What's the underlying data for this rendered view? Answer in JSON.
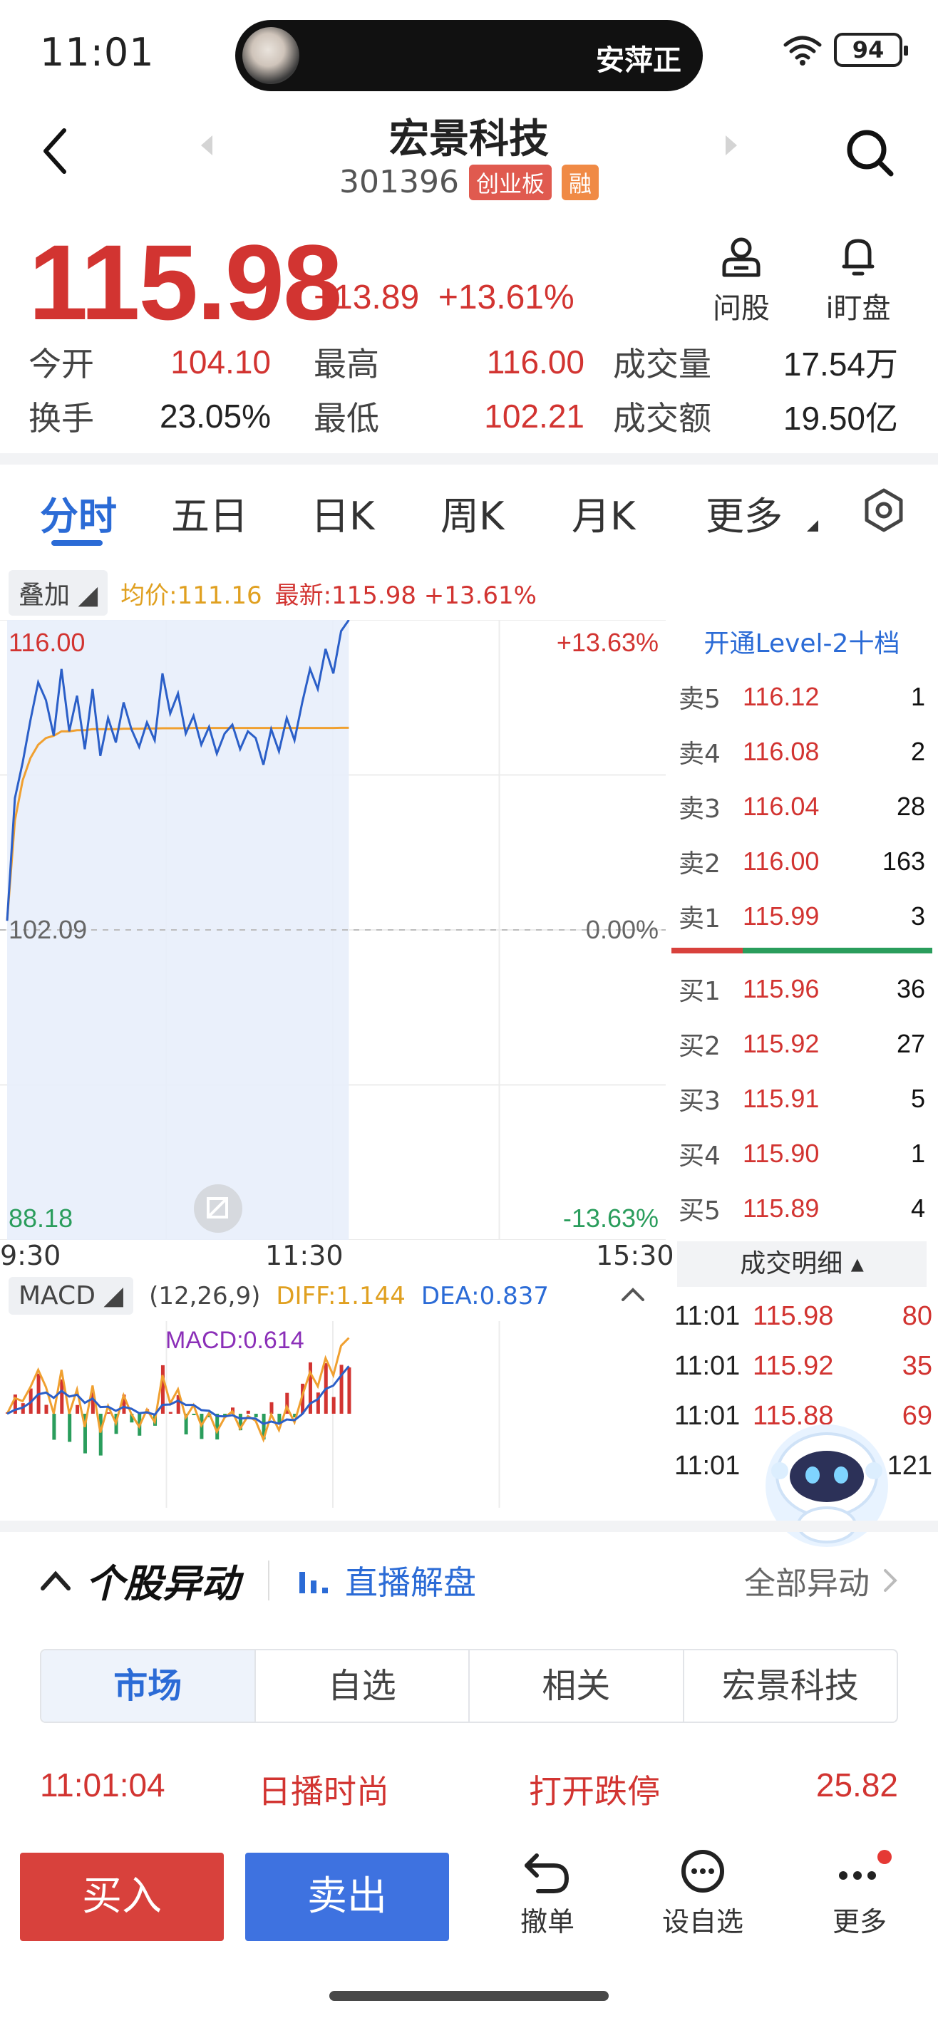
{
  "status": {
    "time": "11:01",
    "ticker": "安萍正",
    "battery": "94"
  },
  "header": {
    "title": "宏景科技",
    "code": "301396",
    "board_tag": "创业板",
    "margin_tag": "融"
  },
  "quote": {
    "price": "115.98",
    "change": "+13.89",
    "change_pct": "+13.61%"
  },
  "actions": {
    "ask": "问股",
    "watch": "i盯盘"
  },
  "stats": {
    "open_label": "今开",
    "open": "104.10",
    "high_label": "最高",
    "high": "116.00",
    "volume_label": "成交量",
    "volume": "17.54万",
    "turnover_label": "换手",
    "turnover": "23.05%",
    "low_label": "最低",
    "low": "102.21",
    "amount_label": "成交额",
    "amount": "19.50亿"
  },
  "tabs": [
    "分时",
    "五日",
    "日K",
    "周K",
    "月K",
    "更多"
  ],
  "overlay": {
    "button": "叠加",
    "avg": "均价:111.16",
    "latest": "最新:115.98 +13.61%"
  },
  "chart": {
    "top_price": "116.00",
    "top_pct": "+13.63%",
    "mid_price": "102.09",
    "mid_pct": "0.00%",
    "bot_price": "88.18",
    "bot_pct": "-13.63%",
    "times": [
      "9:30",
      "11:30",
      "15:30"
    ]
  },
  "chart_data": {
    "type": "line",
    "title": "",
    "ylim": [
      88.18,
      116.0
    ],
    "x_labels": [
      "9:30",
      "11:30",
      "15:30"
    ],
    "series": [
      {
        "name": "",
        "values": [
          102.5,
          108.0,
          109.6,
          111.5,
          113.2,
          112.4,
          110.8,
          113.8,
          111.0,
          112.6,
          110.2,
          112.9,
          109.9,
          111.6,
          110.5,
          112.3,
          111.1,
          110.3,
          111.4,
          110.6,
          113.6,
          111.8,
          112.7,
          110.9,
          111.7,
          110.4,
          111.2,
          110.0,
          110.9,
          111.3,
          110.2,
          111.0,
          110.7,
          109.5,
          111.1,
          110.1,
          111.6,
          110.6,
          112.3,
          113.8,
          112.9,
          114.7,
          113.6,
          115.5,
          116.0
        ]
      },
      {
        "name": "均价",
        "values": [
          102.5,
          107.0,
          108.8,
          109.8,
          110.4,
          110.7,
          110.8,
          111.0,
          111.0,
          111.05,
          111.05,
          111.1,
          111.1,
          111.1,
          111.1,
          111.12,
          111.12,
          111.12,
          111.13,
          111.13,
          111.14,
          111.14,
          111.14,
          111.14,
          111.15,
          111.15,
          111.15,
          111.15,
          111.15,
          111.15,
          111.15,
          111.15,
          111.15,
          111.15,
          111.15,
          111.15,
          111.15,
          111.15,
          111.15,
          111.15,
          111.15,
          111.15,
          111.15,
          111.16,
          111.16
        ]
      }
    ]
  },
  "level2_link": "开通Level-2十档",
  "asks": [
    {
      "label": "卖5",
      "price": "116.12",
      "vol": "1"
    },
    {
      "label": "卖4",
      "price": "116.08",
      "vol": "2"
    },
    {
      "label": "卖3",
      "price": "116.04",
      "vol": "28"
    },
    {
      "label": "卖2",
      "price": "116.00",
      "vol": "163"
    },
    {
      "label": "卖1",
      "price": "115.99",
      "vol": "3"
    }
  ],
  "bids": [
    {
      "label": "买1",
      "price": "115.96",
      "vol": "36"
    },
    {
      "label": "买2",
      "price": "115.92",
      "vol": "27"
    },
    {
      "label": "买3",
      "price": "115.91",
      "vol": "5"
    },
    {
      "label": "买4",
      "price": "115.90",
      "vol": "1"
    },
    {
      "label": "买5",
      "price": "115.89",
      "vol": "4"
    }
  ],
  "deals_title": "成交明细",
  "deals": [
    {
      "time": "11:01",
      "price": "115.98",
      "vol": "80",
      "dir": "red"
    },
    {
      "time": "11:01",
      "price": "115.92",
      "vol": "35",
      "dir": "red"
    },
    {
      "time": "11:01",
      "price": "115.88",
      "vol": "69",
      "dir": "red"
    },
    {
      "time": "11:01",
      "price": "",
      "vol": "121",
      "dir": "dark"
    }
  ],
  "macd": {
    "label": "MACD",
    "params": "(12,26,9)",
    "diff": "DIFF:1.144",
    "dea": "DEA:0.837",
    "macd": "MACD:0.614"
  },
  "anomaly": {
    "title": "个股异动",
    "live": "直播解盘",
    "all": "全部异动",
    "segments": [
      "市场",
      "自选",
      "相关",
      "宏景科技"
    ],
    "news": {
      "time": "11:01:04",
      "name": "日播时尚",
      "event": "打开跌停",
      "value": "25.82"
    }
  },
  "bottom": {
    "buy": "买入",
    "sell": "卖出",
    "cancel": "撤单",
    "watchlist": "设自选",
    "more": "更多"
  },
  "colors": {
    "up": "#d23431",
    "down": "#2a9d5c",
    "accent": "#2b6bd6",
    "avg_line": "#f0a030"
  }
}
